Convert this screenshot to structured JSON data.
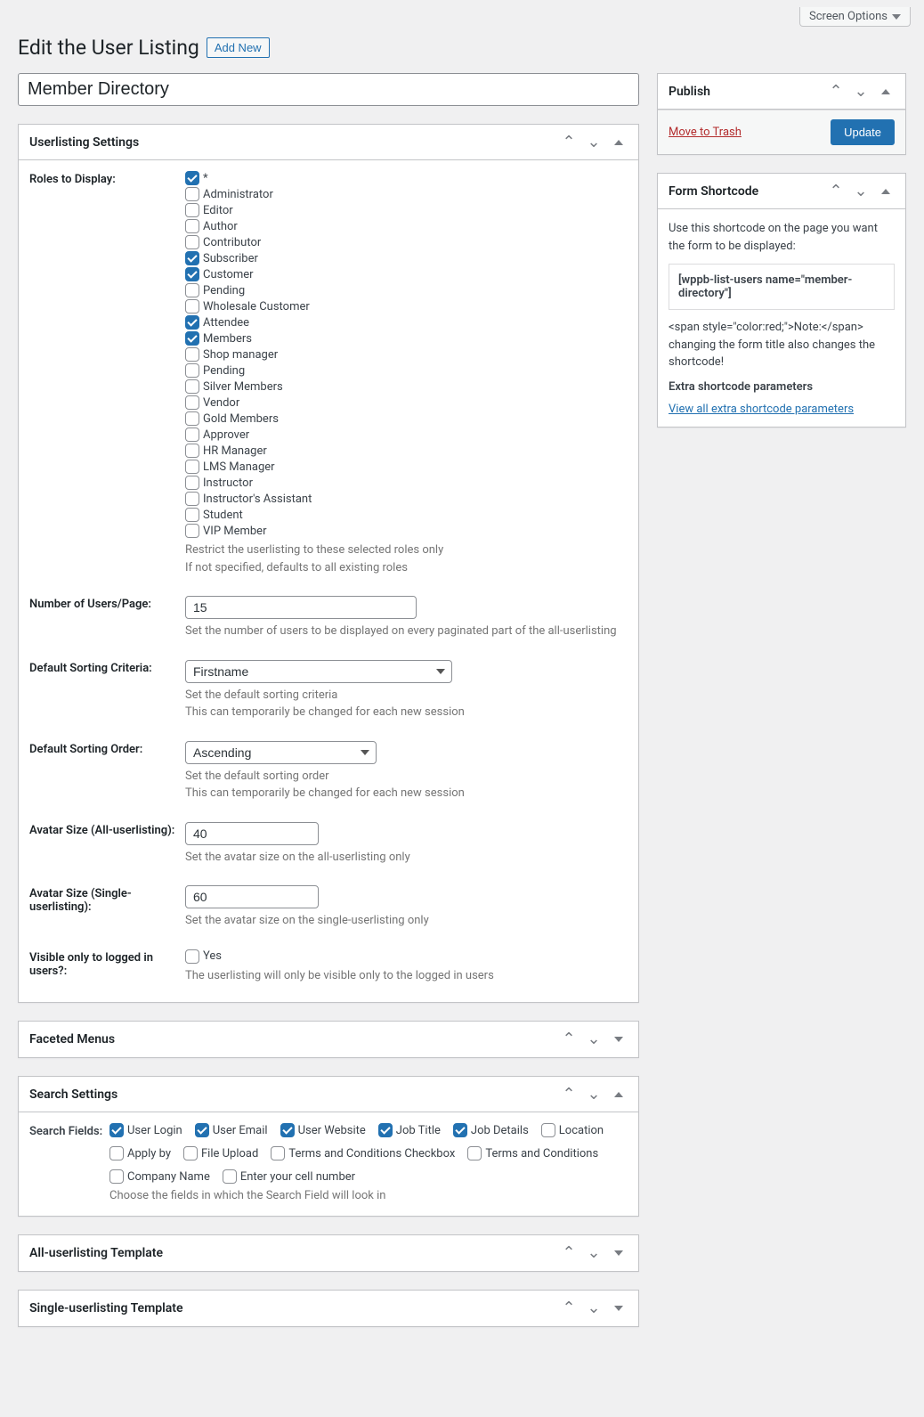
{
  "screenOptions": "Screen Options",
  "pageTitle": "Edit the User Listing",
  "addNew": "Add New",
  "formTitle": "Member Directory",
  "panels": {
    "settings": "Userlisting Settings",
    "faceted": "Faceted Menus",
    "search": "Search Settings",
    "allTemplate": "All-userlisting Template",
    "singleTemplate": "Single-userlisting Template"
  },
  "labels": {
    "roles": "Roles to Display:",
    "usersPage": "Number of Users/Page:",
    "sortCriteria": "Default Sorting Criteria:",
    "sortOrder": "Default Sorting Order:",
    "avatarAll": "Avatar Size (All-userlisting):",
    "avatarSingle": "Avatar Size (Single-userlisting):",
    "visibleLogged": "Visible only to logged in users?:",
    "searchFields": "Search Fields:"
  },
  "roles": [
    {
      "label": "*",
      "checked": true
    },
    {
      "label": "Administrator",
      "checked": false
    },
    {
      "label": "Editor",
      "checked": false
    },
    {
      "label": "Author",
      "checked": false
    },
    {
      "label": "Contributor",
      "checked": false
    },
    {
      "label": "Subscriber",
      "checked": true
    },
    {
      "label": "Customer",
      "checked": true
    },
    {
      "label": "Pending",
      "checked": false
    },
    {
      "label": "Wholesale Customer",
      "checked": false
    },
    {
      "label": "Attendee",
      "checked": true
    },
    {
      "label": "Members",
      "checked": true
    },
    {
      "label": "Shop manager",
      "checked": false
    },
    {
      "label": "Pending",
      "checked": false
    },
    {
      "label": "Silver Members",
      "checked": false
    },
    {
      "label": "Vendor",
      "checked": false
    },
    {
      "label": "Gold Members",
      "checked": false
    },
    {
      "label": "Approver",
      "checked": false
    },
    {
      "label": "HR Manager",
      "checked": false
    },
    {
      "label": "LMS Manager",
      "checked": false
    },
    {
      "label": "Instructor",
      "checked": false
    },
    {
      "label": "Instructor's Assistant",
      "checked": false
    },
    {
      "label": "Student",
      "checked": false
    },
    {
      "label": "VIP Member",
      "checked": false
    }
  ],
  "rolesDesc1": "Restrict the userlisting to these selected roles only",
  "rolesDesc2": "If not specified, defaults to all existing roles",
  "usersPageValue": "15",
  "usersPageDesc": "Set the number of users to be displayed on every paginated part of the all-userlisting",
  "sortCriteriaValue": "Firstname",
  "sortCriteriaDesc1": "Set the default sorting criteria",
  "sortCriteriaDesc2": "This can temporarily be changed for each new session",
  "sortOrderValue": "Ascending",
  "sortOrderDesc1": "Set the default sorting order",
  "sortOrderDesc2": "This can temporarily be changed for each new session",
  "avatarAllValue": "40",
  "avatarAllDesc": "Set the avatar size on the all-userlisting only",
  "avatarSingleValue": "60",
  "avatarSingleDesc": "Set the avatar size on the single-userlisting only",
  "visibleYes": "Yes",
  "visibleDesc": "The userlisting will only be visible only to the logged in users",
  "searchFields": [
    {
      "label": "User Login",
      "checked": true
    },
    {
      "label": "User Email",
      "checked": true
    },
    {
      "label": "User Website",
      "checked": true
    },
    {
      "label": "Job Title",
      "checked": true
    },
    {
      "label": "Job Details",
      "checked": true
    },
    {
      "label": "Location",
      "checked": false
    },
    {
      "label": "Apply by",
      "checked": false
    },
    {
      "label": "File Upload",
      "checked": false
    },
    {
      "label": "Terms and Conditions Checkbox",
      "checked": false
    },
    {
      "label": "Terms and Conditions",
      "checked": false
    },
    {
      "label": "Company Name",
      "checked": false
    },
    {
      "label": "Enter your cell number",
      "checked": false
    }
  ],
  "searchFieldsDesc": "Choose the fields in which the Search Field will look in",
  "publish": {
    "title": "Publish",
    "trash": "Move to Trash",
    "update": "Update"
  },
  "shortcode": {
    "title": "Form Shortcode",
    "intro": "Use this shortcode on the page you want the form to be displayed:",
    "code": "[wppb-list-users name=\"member-directory\"]",
    "note": "<span style=\"color:red;\">Note:</span> changing the form title also changes the shortcode!",
    "extra": "Extra shortcode parameters",
    "viewAll": "View all extra shortcode parameters"
  }
}
